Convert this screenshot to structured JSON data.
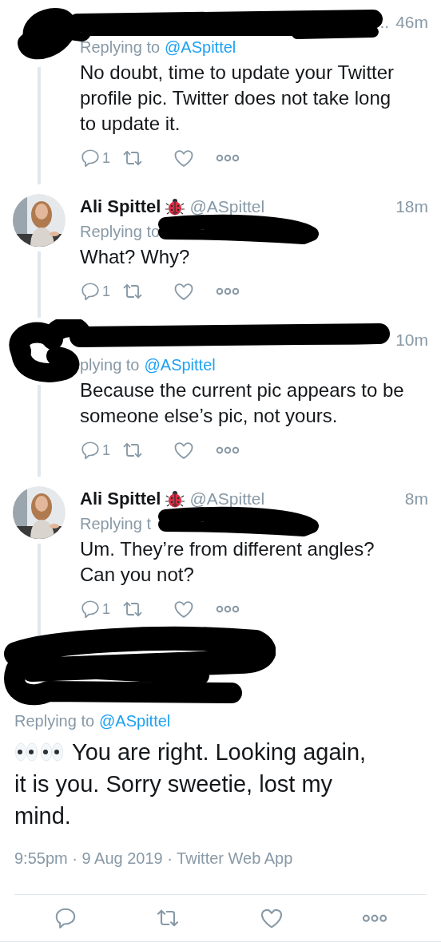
{
  "tweets": [
    {
      "header_redacted": true,
      "replying_redacted": false,
      "author": {
        "tail": ".."
      },
      "time": "46m",
      "replying_label": "Replying to",
      "replying_handle": "@ASpittel",
      "text": "No doubt, time to update your Twitter profile pic. Twitter does not take long to update it.",
      "reply_count": "1"
    },
    {
      "header_redacted": false,
      "replying_redacted": true,
      "author": {
        "name": "Ali Spittel",
        "handle": "@ASpittel"
      },
      "time": "18m",
      "replying_label": "Replying to",
      "text": "What? Why?",
      "reply_count": "1"
    },
    {
      "header_redacted": true,
      "replying_redacted": false,
      "time": "10m",
      "replying_label": "plying to",
      "replying_handle": "@ASpittel",
      "text": "Because the current pic appears to be someone else’s pic, not yours.",
      "reply_count": "1"
    },
    {
      "header_redacted": false,
      "replying_redacted": true,
      "author": {
        "name": "Ali Spittel",
        "handle": "@ASpittel"
      },
      "time": "8m",
      "replying_label": "Replying t",
      "text": "Um. They’re from different angles? Can you not?",
      "reply_count": "1"
    }
  ],
  "main_tweet": {
    "header_redacted": true,
    "replying_label": "Replying to",
    "replying_handle": "@ASpittel",
    "text_lines": [
      "You are right. Looking again,",
      "it is you. Sorry sweetie, lost my mind."
    ],
    "timestamp": "9:55pm · 9 Aug 2019 · Twitter Web App"
  }
}
